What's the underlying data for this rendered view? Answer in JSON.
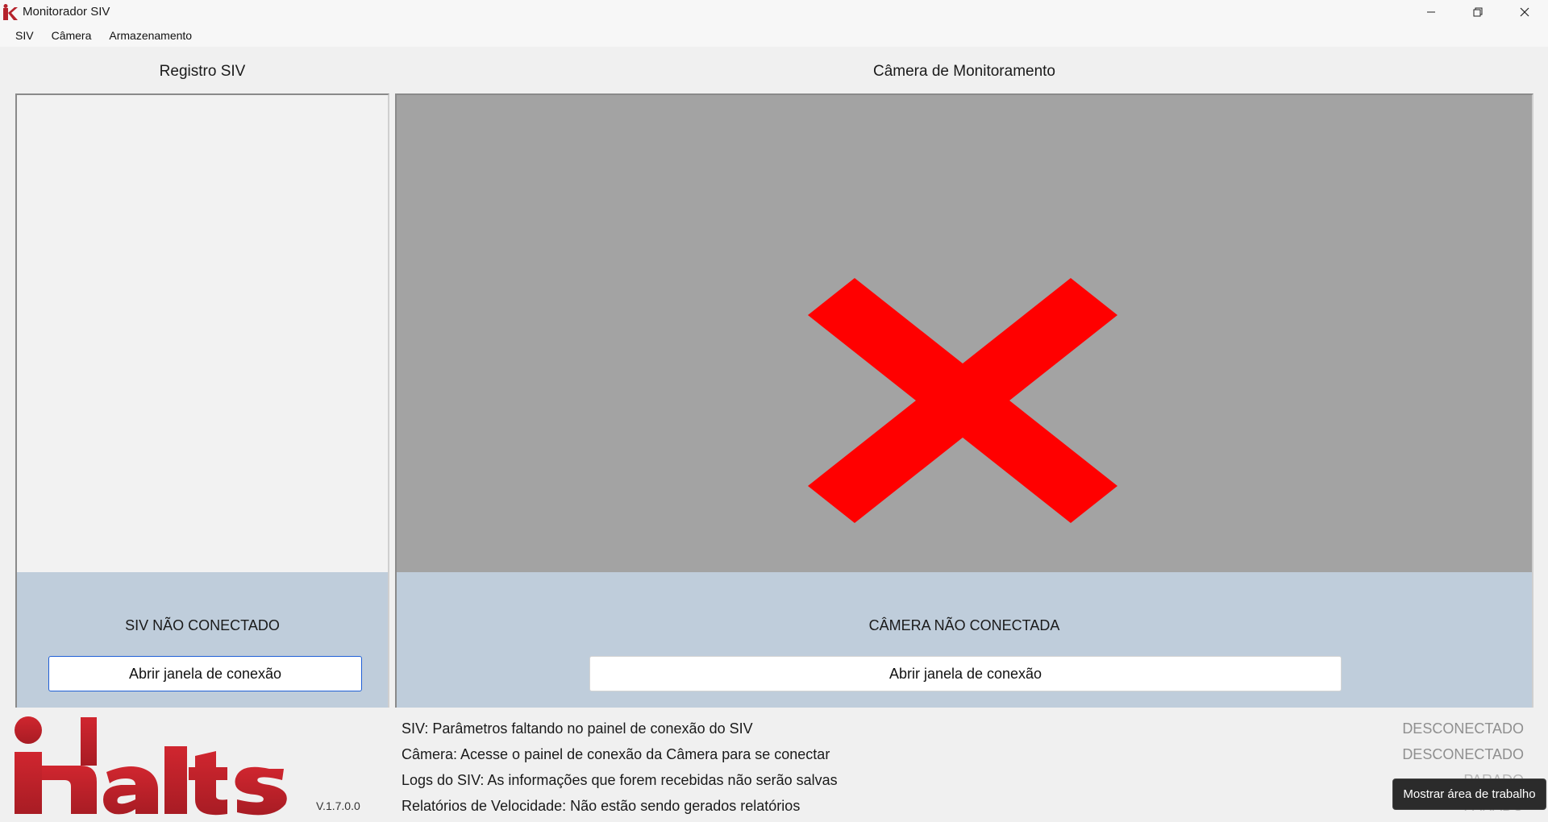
{
  "window": {
    "title": "Monitorador SIV",
    "controls": {
      "minimize": "—",
      "restore": "❐",
      "close": "✕"
    }
  },
  "menu": {
    "items": [
      "SIV",
      "Câmera",
      "Armazenamento"
    ]
  },
  "siv_panel": {
    "title": "Registro SIV",
    "status": "SIV NÃO CONECTADO",
    "button_label": "Abrir janela de conexão"
  },
  "camera_panel": {
    "title": "Câmera de Monitoramento",
    "status": "CÂMERA NÃO CONECTADA",
    "button_label": "Abrir janela de conexão",
    "placeholder_icon": "red-x-icon"
  },
  "footer": {
    "logo_text": "Kalts",
    "version": "V.1.7.0.0",
    "info": [
      {
        "label": "SIV: Parâmetros faltando no painel de conexão do SIV",
        "state": "DESCONECTADO"
      },
      {
        "label": "Câmera: Acesse o painel de conexão da Câmera para se conectar",
        "state": "DESCONECTADO"
      },
      {
        "label": "Logs do SIV: As informações que forem recebidas não serão salvas",
        "state": "PARADO"
      },
      {
        "label": "Relatórios de Velocidade: Não estão sendo gerados relatórios",
        "state": "PARADO"
      }
    ]
  },
  "tooltip": {
    "text": "Mostrar área de trabalho"
  },
  "colors": {
    "status_bg": "#bfcddb",
    "camera_bg": "#a3a3a3",
    "error_red": "#ff0000",
    "brand_red": "#b5222b"
  }
}
